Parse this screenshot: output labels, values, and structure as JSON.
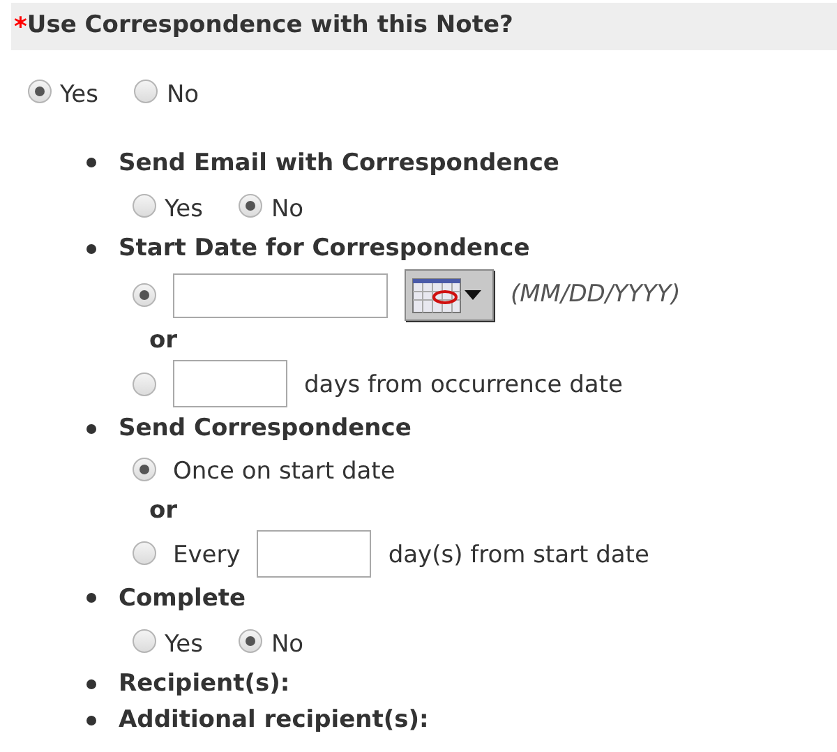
{
  "header": {
    "required_mark": "*",
    "title": "Use Correspondence with this Note?"
  },
  "use_options": [
    {
      "label": "Yes",
      "selected": true
    },
    {
      "label": "No",
      "selected": false
    }
  ],
  "items": [
    {
      "kind": "inline",
      "label": "Send Email with Correspondence",
      "options": [
        {
          "label": "Yes",
          "selected": false
        },
        {
          "label": "No",
          "selected": true
        }
      ]
    },
    {
      "kind": "choices",
      "label": "Start Date for Correspondence",
      "separator": "or",
      "choices": [
        {
          "selected": true,
          "parts": [
            {
              "kind": "date"
            },
            {
              "kind": "hint",
              "text": "(MM/DD/YYYY)"
            }
          ]
        },
        {
          "selected": false,
          "parts": [
            {
              "kind": "field"
            },
            {
              "kind": "text",
              "text": "days from occurrence date"
            }
          ]
        }
      ]
    },
    {
      "kind": "choices",
      "label": "Send Correspondence",
      "separator": "or",
      "choices": [
        {
          "selected": true,
          "parts": [
            {
              "kind": "text",
              "text": "Once on start date"
            }
          ]
        },
        {
          "selected": false,
          "parts": [
            {
              "kind": "text",
              "text": "Every"
            },
            {
              "kind": "field"
            },
            {
              "kind": "text",
              "text": "day(s) from start date"
            }
          ]
        }
      ]
    },
    {
      "kind": "inline",
      "label": "Complete",
      "options": [
        {
          "label": "Yes",
          "selected": false
        },
        {
          "label": "No",
          "selected": true
        }
      ]
    },
    {
      "kind": "plain",
      "label": "Recipient(s):"
    },
    {
      "kind": "plain",
      "label": "Additional recipient(s):"
    }
  ]
}
